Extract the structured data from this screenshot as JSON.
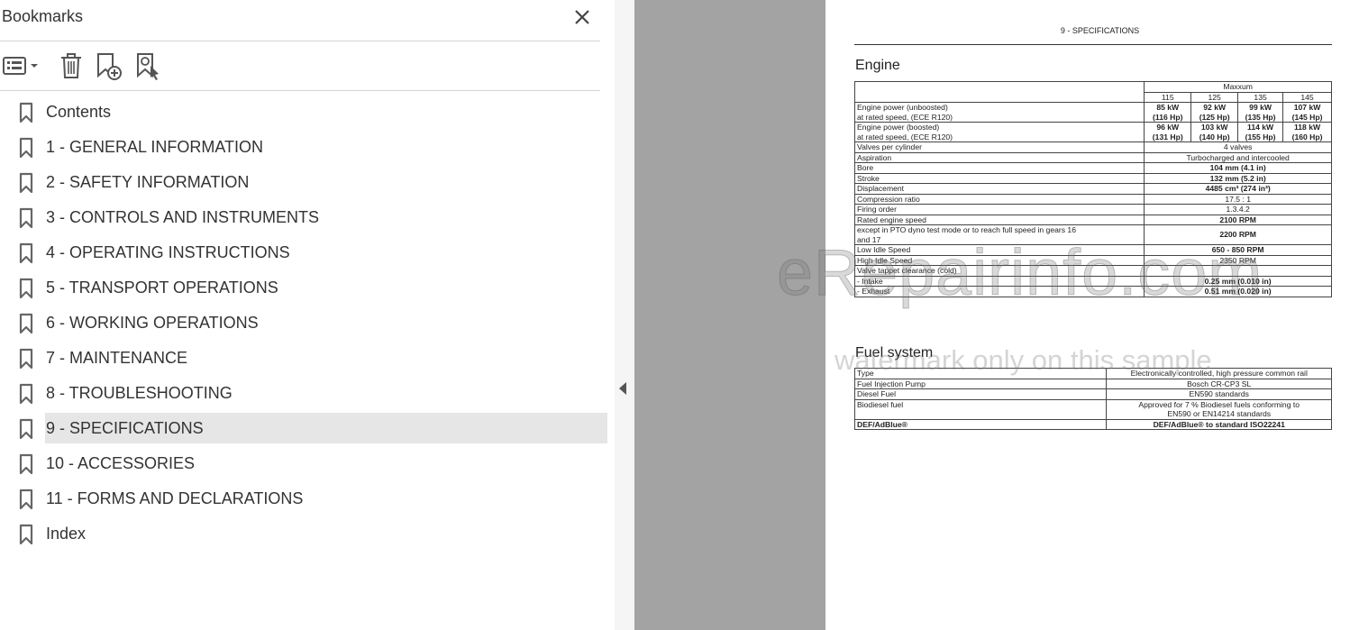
{
  "bookmarks": {
    "title": "Bookmarks",
    "items": [
      {
        "label": "Contents"
      },
      {
        "label": "1 - GENERAL INFORMATION"
      },
      {
        "label": "2 - SAFETY INFORMATION"
      },
      {
        "label": "3 - CONTROLS AND INSTRUMENTS"
      },
      {
        "label": "4 - OPERATING INSTRUCTIONS"
      },
      {
        "label": "5 - TRANSPORT OPERATIONS"
      },
      {
        "label": "6 - WORKING OPERATIONS"
      },
      {
        "label": "7 - MAINTENANCE"
      },
      {
        "label": "8 - TROUBLESHOOTING"
      },
      {
        "label": "9 - SPECIFICATIONS",
        "selected": true
      },
      {
        "label": "10 - ACCESSORIES"
      },
      {
        "label": "11 - FORMS AND DECLARATIONS"
      },
      {
        "label": "Index"
      }
    ]
  },
  "document": {
    "header": "9 - SPECIFICATIONS",
    "engine": {
      "title": "Engine",
      "model": "Maxxum",
      "variants": [
        "115",
        "125",
        "135",
        "145"
      ],
      "power_unboosted": {
        "label1": "Engine power (unboosted)",
        "label2": "at rated speed, (ECE R120)",
        "values": [
          [
            "85 kW",
            "(116 Hp)"
          ],
          [
            "92 kW",
            "(125 Hp)"
          ],
          [
            "99 kW",
            "(135 Hp)"
          ],
          [
            "107 kW",
            "(145 Hp)"
          ]
        ]
      },
      "power_boosted": {
        "label1": "Engine power (boosted)",
        "label2": "at rated speed, (ECE R120)",
        "values": [
          [
            "96 kW",
            "(131 Hp)"
          ],
          [
            "103 kW",
            "(140 Hp)"
          ],
          [
            "114 kW",
            "(155 Hp)"
          ],
          [
            "118 kW",
            "(160 Hp)"
          ]
        ]
      },
      "rows": {
        "valves": {
          "label": "Valves per cylinder",
          "value": "4 valves"
        },
        "aspiration": {
          "label": "Aspiration",
          "value": "Turbocharged and intercooled"
        },
        "bore": {
          "label": "Bore",
          "value": "104 mm (4.1 in)"
        },
        "stroke": {
          "label": "Stroke",
          "value": "132 mm (5.2 in)"
        },
        "displacement": {
          "label": "Displacement",
          "value": "4485 cm³ (274 in³)"
        },
        "compression": {
          "label": "Compression ratio",
          "value": "17.5 : 1"
        },
        "firing": {
          "label": "Firing order",
          "value": "1.3.4.2"
        },
        "rated": {
          "label": "Rated engine speed",
          "value": "2100 RPM"
        },
        "pto1": "except in PTO dyno test mode or to reach full speed in gears 16",
        "pto2": "and 17",
        "pto_value": "2200 RPM",
        "low_idle": {
          "label": "Low Idle Speed",
          "value": "650 - 850 RPM"
        },
        "high_idle": {
          "label": "High Idle Speed",
          "value": "2350 RPM"
        },
        "tappet": {
          "label": "Valve tappet clearance (cold)"
        },
        "intake": {
          "label": "- Intake",
          "value": "0.25 mm (0.010 in)"
        },
        "exhaust": {
          "label": "- Exhaust",
          "value": "0.51 mm (0.020 in)"
        }
      }
    },
    "fuel": {
      "title": "Fuel system",
      "type": {
        "label": "Type",
        "value": "Electronically controlled, high pressure common rail"
      },
      "pump": {
        "label": "Fuel Injection Pump",
        "value": "Bosch CR-CP3 SL"
      },
      "diesel": {
        "label": "Diesel Fuel",
        "value": "EN590 standards"
      },
      "biodiesel": {
        "label": "Biodiesel fuel",
        "value1": "Approved for 7 % Biodiesel fuels conforming to",
        "value2": "EN590 or EN14214 standards"
      },
      "def": {
        "label": "DEF/AdBlue®",
        "value": "DEF/AdBlue® to standard ISO22241"
      }
    },
    "watermark": {
      "line1": "eRepairinfo.com",
      "line2": "watermark only on this sample"
    }
  },
  "icons": {
    "close": "close-icon",
    "options": "bookmark-options-icon",
    "delete": "trash-icon",
    "add": "add-bookmark-icon",
    "find": "find-current-bookmark-icon",
    "bookmark": "bookmark-icon",
    "collapse": "collapse-panel-arrow-icon"
  }
}
